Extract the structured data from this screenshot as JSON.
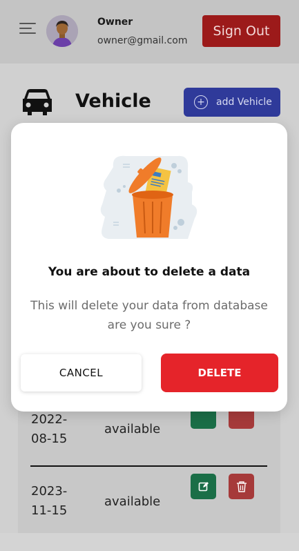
{
  "header": {
    "owner_name": "Owner",
    "owner_email": "owner@gmail.com",
    "signout_label": "Sign Out"
  },
  "vehicle": {
    "title": "Vehicle",
    "add_button_label": "add Vehicle"
  },
  "table": {
    "rows": [
      {
        "date_line1": "2022-",
        "date_line2": "08-15",
        "status": "available"
      },
      {
        "date_line1": "2023-",
        "date_line2": "11-15",
        "status": "available"
      }
    ]
  },
  "modal": {
    "title": "You are about to delete a data",
    "message": "This will delete your data from database are you sure ?",
    "cancel_label": "CANCEL",
    "delete_label": "DELETE"
  },
  "icons": {
    "menu": "menu-icon",
    "car": "car-icon",
    "add": "plus-circle-icon",
    "edit": "edit-icon",
    "delete": "trash-icon",
    "illustration": "trash-bin-illustration"
  },
  "colors": {
    "signout": "#9c1a1a",
    "add_vehicle": "#2f3a9a",
    "delete": "#e5242a",
    "edit": "#1a6e47",
    "trash": "#a63a3a",
    "bin_orange": "#f07c2a"
  }
}
